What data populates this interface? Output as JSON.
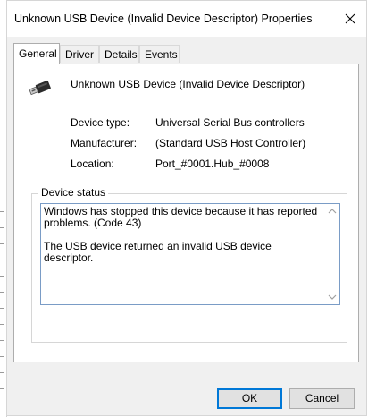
{
  "window": {
    "title": "Unknown USB Device (Invalid Device Descriptor) Properties"
  },
  "tabs": [
    {
      "label": "General",
      "active": true
    },
    {
      "label": "Driver",
      "active": false
    },
    {
      "label": "Details",
      "active": false
    },
    {
      "label": "Events",
      "active": false
    }
  ],
  "device": {
    "name": "Unknown USB Device (Invalid Device Descriptor)",
    "icon": "usb-device-icon"
  },
  "properties": [
    {
      "label": "Device type:",
      "value": "Universal Serial Bus controllers"
    },
    {
      "label": "Manufacturer:",
      "value": "(Standard USB Host Controller)"
    },
    {
      "label": "Location:",
      "value": "Port_#0001.Hub_#0008"
    }
  ],
  "device_status": {
    "legend": "Device status",
    "text": "Windows has stopped this device because it has reported\nproblems. (Code 43)\n\nThe USB device returned an invalid USB device descriptor."
  },
  "buttons": {
    "ok": "OK",
    "cancel": "Cancel"
  },
  "colors": {
    "accent": "#0078d7",
    "dialog_bg": "#f0f0f0"
  }
}
